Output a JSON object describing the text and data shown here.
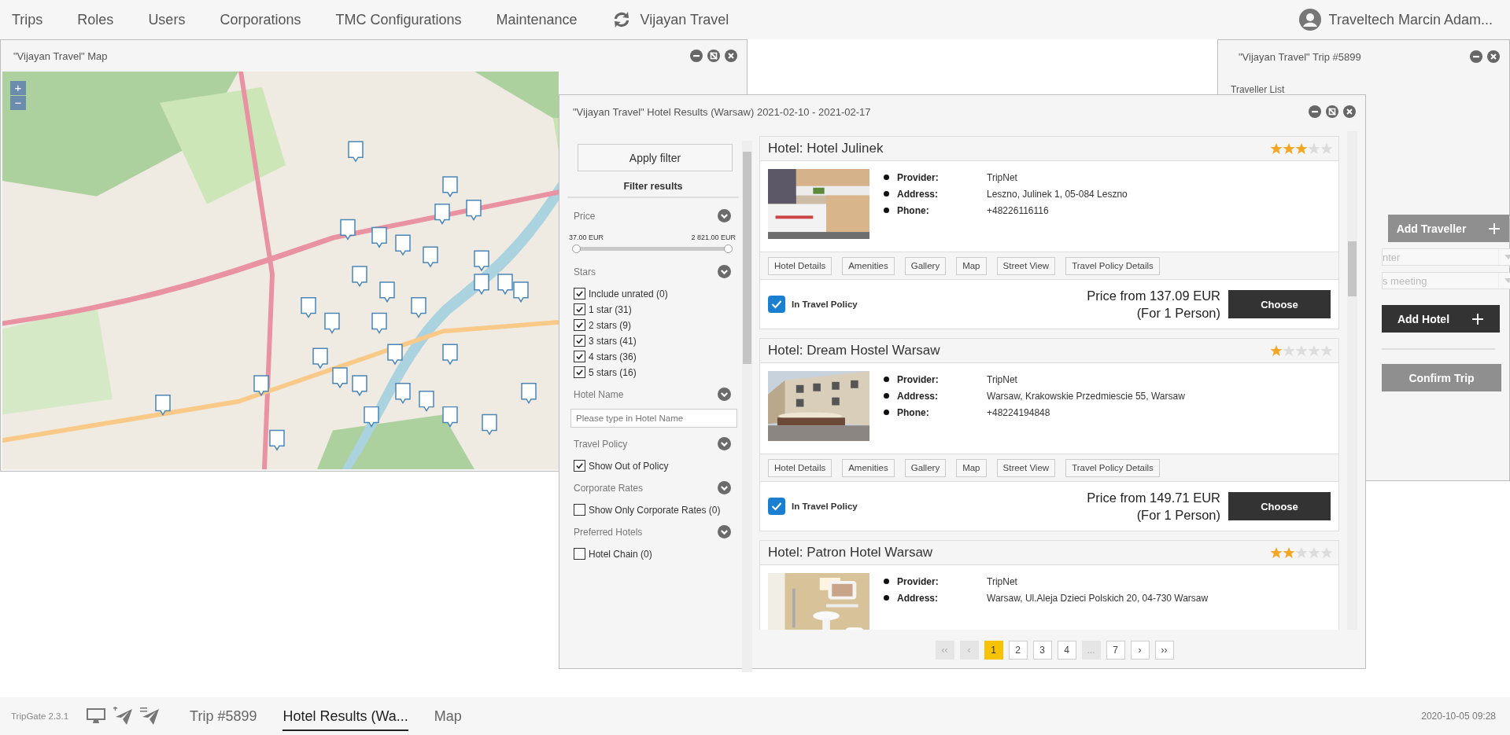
{
  "nav": {
    "items": [
      "Trips",
      "Roles",
      "Users",
      "Corporations",
      "TMC Configurations",
      "Maintenance"
    ],
    "brand": "Vijayan Travel",
    "user": "Traveltech Marcin Adam..."
  },
  "map_window": {
    "title": "\"Vijayan Travel\" Map",
    "zoom_in": "+",
    "zoom_out": "−"
  },
  "trip_window": {
    "title": "\"Vijayan Travel\" Trip #5899",
    "traveller_list": "Traveller List",
    "add_traveller": {
      "label": "Add Traveller",
      "disabled": true
    },
    "selects": [
      {
        "value": "nter"
      },
      {
        "value": "s meeting"
      }
    ],
    "add_hotel": {
      "label": "Add Hotel",
      "disabled": false
    },
    "confirm_trip": {
      "label": "Confirm Trip",
      "disabled": true
    }
  },
  "hotel_window": {
    "title": "\"Vijayan Travel\" Hotel Results (Warsaw) 2021-02-10 - 2021-02-17",
    "filter": {
      "apply_button": "Apply filter",
      "heading": "Filter results",
      "sections": [
        {
          "kind": "range",
          "title": "Price",
          "min_label": "37.00 EUR",
          "max_label": "2 821.00 EUR",
          "level": 1
        },
        {
          "kind": "checkboxes",
          "title": "Stars",
          "options": [
            {
              "label": "Include unrated (0)",
              "checked": true
            },
            {
              "label": "1 star (31)",
              "checked": true
            },
            {
              "label": "2 stars (9)",
              "checked": true
            },
            {
              "label": "3 stars (41)",
              "checked": true
            },
            {
              "label": "4 stars (36)",
              "checked": true
            },
            {
              "label": "5 stars (16)",
              "checked": true
            }
          ]
        },
        {
          "kind": "text",
          "title": "Hotel Name",
          "placeholder": "Please type in Hotel Name"
        },
        {
          "kind": "checkboxes",
          "title": "Travel Policy",
          "options": [
            {
              "label": "Show Out of Policy",
              "checked": true
            }
          ]
        },
        {
          "kind": "checkboxes",
          "title": "Corporate Rates",
          "options": [
            {
              "label": "Show Only Corporate Rates (0)",
              "checked": false
            }
          ]
        },
        {
          "kind": "checkboxes",
          "title": "Preferred Hotels",
          "options": [
            {
              "label": "Hotel Chain (0)",
              "checked": false
            }
          ]
        }
      ]
    },
    "hotels": [
      {
        "name": "Hotel: Hotel Julinek",
        "stars": 3,
        "details": [
          {
            "label": "Provider:",
            "value": "TripNet"
          },
          {
            "label": "Address:",
            "value": "Leszno, Julinek 1, 05-084 Leszno"
          },
          {
            "label": "Phone:",
            "value": "+48226116116"
          }
        ],
        "actions": [
          "Hotel Details",
          "Amenities",
          "Gallery",
          "Map",
          "Street View",
          "Travel Policy Details"
        ],
        "policy": {
          "label": "In Travel Policy",
          "checked": true
        },
        "price": "Price from 137.09 EUR",
        "price_note": "(For 1 Person)",
        "choose": "Choose"
      },
      {
        "name": "Hotel: Dream Hostel Warsaw",
        "stars": 1,
        "details": [
          {
            "label": "Provider:",
            "value": "TripNet"
          },
          {
            "label": "Address:",
            "value": "Warsaw, Krakowskie Przedmiescie 55, Warsaw"
          },
          {
            "label": "Phone:",
            "value": "+48224194848"
          }
        ],
        "actions": [
          "Hotel Details",
          "Amenities",
          "Gallery",
          "Map",
          "Street View",
          "Travel Policy Details"
        ],
        "policy": {
          "label": "In Travel Policy",
          "checked": true
        },
        "price": "Price from 149.71 EUR",
        "price_note": "(For 1 Person)",
        "choose": "Choose"
      },
      {
        "name": "Hotel: Patron Hotel Warsaw",
        "stars": 2,
        "details": [
          {
            "label": "Provider:",
            "value": "TripNet"
          },
          {
            "label": "Address:",
            "value": "Warsaw, Ul.Aleja Dzieci Polskich 20, 04-730 Warsaw"
          }
        ]
      }
    ],
    "pagination": [
      {
        "label": "‹‹",
        "selected": false,
        "disabled": true
      },
      {
        "label": "‹",
        "selected": false,
        "disabled": true
      },
      {
        "label": "1",
        "selected": true,
        "disabled": false
      },
      {
        "label": "2",
        "selected": false,
        "disabled": false
      },
      {
        "label": "3",
        "selected": false,
        "disabled": false
      },
      {
        "label": "4",
        "selected": false,
        "disabled": false
      },
      {
        "label": "...",
        "selected": false,
        "disabled": true
      },
      {
        "label": "7",
        "selected": false,
        "disabled": false
      },
      {
        "label": "›",
        "selected": false,
        "disabled": false
      },
      {
        "label": "››",
        "selected": false,
        "disabled": false
      }
    ]
  },
  "status_bar": {
    "version": "TripGate 2.3.1",
    "tabs": [
      {
        "label": "Trip #5899",
        "selected": false
      },
      {
        "label": "Hotel Results (Wa...",
        "selected": true
      },
      {
        "label": "Map",
        "selected": false
      }
    ],
    "time": "2020-10-05 09:28"
  }
}
